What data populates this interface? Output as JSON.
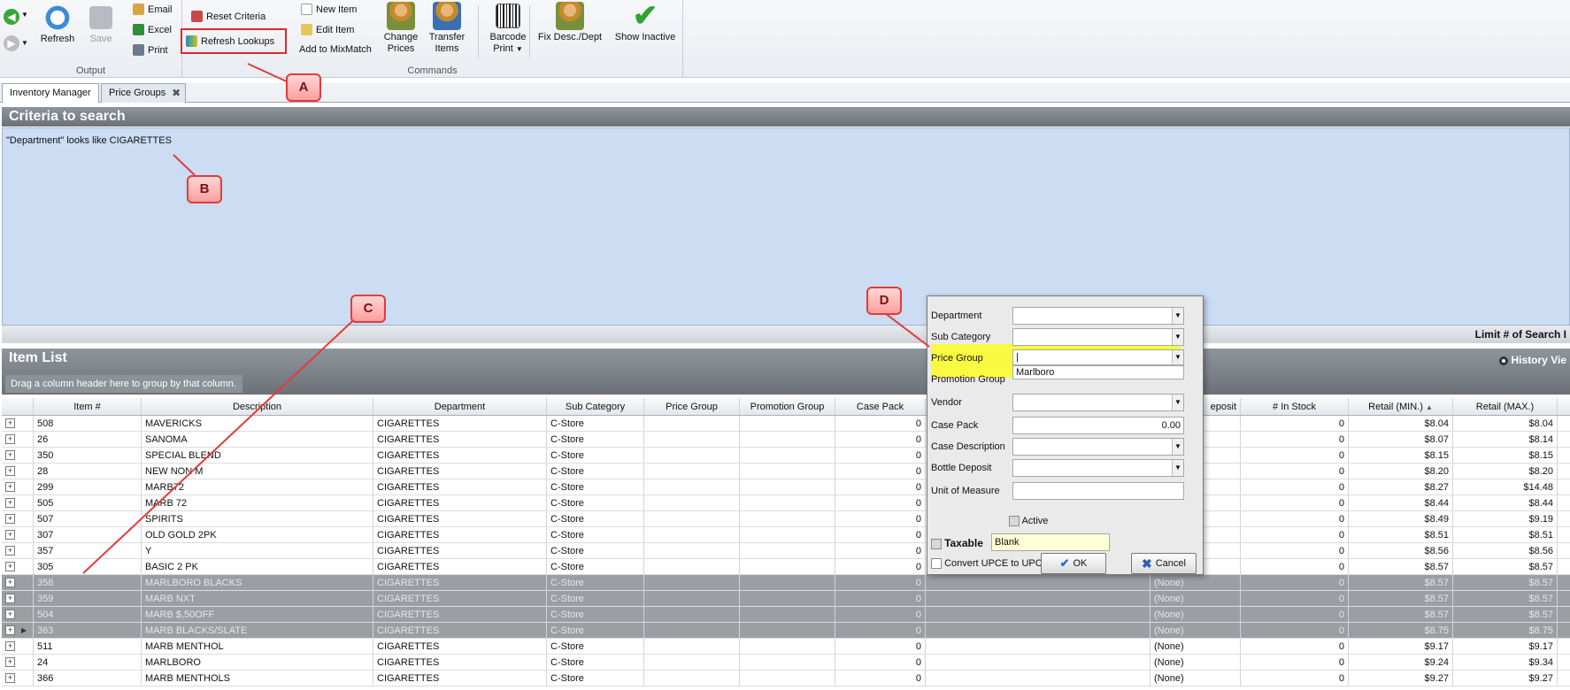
{
  "ribbon": {
    "output_group": "Output",
    "commands_group": "Commands",
    "refresh": "Refresh",
    "save": "Save",
    "email": "Email",
    "excel": "Excel",
    "print": "Print",
    "reset_criteria": "Reset Criteria",
    "refresh_lookups": "Refresh Lookups",
    "new_item": "New Item",
    "edit_item": "Edit Item",
    "add_mixmatch": "Add to MixMatch",
    "change_prices": "Change\nPrices",
    "change_prices_1": "Change",
    "change_prices_2": "Prices",
    "transfer_1": "Transfer",
    "transfer_2": "Items",
    "barcode_1": "Barcode",
    "barcode_2": "Print",
    "fix_desc": "Fix Desc./Dept",
    "show_inactive": "Show Inactive"
  },
  "callouts": {
    "a": "A",
    "b": "B",
    "c": "C",
    "d": "D"
  },
  "tabs": [
    {
      "label": "Inventory Manager"
    },
    {
      "label": "Price Groups"
    }
  ],
  "criteria": {
    "title": "Criteria to search",
    "text": "\"Department\" looks like CIGARETTES",
    "limit": "Limit # of Search I"
  },
  "item_list": {
    "title": "Item List",
    "group_hint": "Drag a column header here to group by that column.",
    "history": "History Vie"
  },
  "columns": {
    "item": "Item #",
    "desc": "Description",
    "dept": "Department",
    "subcat": "Sub Category",
    "pricegroup": "Price Group",
    "promo": "Promotion Group",
    "casepack": "Case Pack",
    "deposit": "eposit",
    "instock": "# In Stock",
    "retailmin": "Retail (MIN.)",
    "retailmax": "Retail (MAX.)"
  },
  "rows": [
    {
      "item": "508",
      "desc": "MAVERICKS",
      "dept": "CIGARETTES",
      "subcat": "C-Store",
      "casepack": "0",
      "deposit": "",
      "instock": "0",
      "min": "$8.04",
      "max": "$8.04"
    },
    {
      "item": "26",
      "desc": "SANOMA",
      "dept": "CIGARETTES",
      "subcat": "C-Store",
      "casepack": "0",
      "deposit": "",
      "instock": "0",
      "min": "$8.07",
      "max": "$8.14"
    },
    {
      "item": "350",
      "desc": "SPECIAL BLEND",
      "dept": "CIGARETTES",
      "subcat": "C-Store",
      "casepack": "0",
      "deposit": "",
      "instock": "0",
      "min": "$8.15",
      "max": "$8.15"
    },
    {
      "item": "28",
      "desc": "NEW NON M",
      "dept": "CIGARETTES",
      "subcat": "C-Store",
      "casepack": "0",
      "deposit": "",
      "instock": "0",
      "min": "$8.20",
      "max": "$8.20"
    },
    {
      "item": "299",
      "desc": "MARB72",
      "dept": "CIGARETTES",
      "subcat": "C-Store",
      "casepack": "0",
      "deposit": "",
      "instock": "0",
      "min": "$8.27",
      "max": "$14.48"
    },
    {
      "item": "505",
      "desc": "MARB 72",
      "dept": "CIGARETTES",
      "subcat": "C-Store",
      "casepack": "0",
      "deposit": "",
      "instock": "0",
      "min": "$8.44",
      "max": "$8.44"
    },
    {
      "item": "507",
      "desc": "SPIRITS",
      "dept": "CIGARETTES",
      "subcat": "C-Store",
      "casepack": "0",
      "deposit": "",
      "instock": "0",
      "min": "$8.49",
      "max": "$9.19"
    },
    {
      "item": "307",
      "desc": "OLD GOLD 2PK",
      "dept": "CIGARETTES",
      "subcat": "C-Store",
      "casepack": "0",
      "deposit": "",
      "instock": "0",
      "min": "$8.51",
      "max": "$8.51"
    },
    {
      "item": "357",
      "desc": "Y",
      "dept": "CIGARETTES",
      "subcat": "C-Store",
      "casepack": "0",
      "deposit": "",
      "instock": "0",
      "min": "$8.56",
      "max": "$8.56"
    },
    {
      "item": "305",
      "desc": "BASIC 2 PK",
      "dept": "CIGARETTES",
      "subcat": "C-Store",
      "casepack": "0",
      "deposit": "",
      "instock": "0",
      "min": "$8.57",
      "max": "$8.57"
    },
    {
      "item": "358",
      "desc": "MARLBORO BLACKS",
      "dept": "CIGARETTES",
      "subcat": "C-Store",
      "casepack": "0",
      "deposit": "(None)",
      "instock": "0",
      "min": "$8.57",
      "max": "$8.57"
    },
    {
      "item": "359",
      "desc": "MARB NXT",
      "dept": "CIGARETTES",
      "subcat": "C-Store",
      "casepack": "0",
      "deposit": "(None)",
      "instock": "0",
      "min": "$8.57",
      "max": "$8.57"
    },
    {
      "item": "504",
      "desc": "MARB $,50OFF",
      "dept": "CIGARETTES",
      "subcat": "C-Store",
      "casepack": "0",
      "deposit": "(None)",
      "instock": "0",
      "min": "$8.57",
      "max": "$8.57"
    },
    {
      "item": "363",
      "desc": "MARB BLACKS/SLATE",
      "dept": "CIGARETTES",
      "subcat": "C-Store",
      "casepack": "0",
      "deposit": "(None)",
      "instock": "0",
      "min": "$8.75",
      "max": "$8.75"
    },
    {
      "item": "511",
      "desc": "MARB MENTHOL",
      "dept": "CIGARETTES",
      "subcat": "C-Store",
      "casepack": "0",
      "deposit": "(None)",
      "instock": "0",
      "min": "$9.17",
      "max": "$9.17"
    },
    {
      "item": "24",
      "desc": "MARLBORO",
      "dept": "CIGARETTES",
      "subcat": "C-Store",
      "casepack": "0",
      "deposit": "(None)",
      "instock": "0",
      "min": "$9.24",
      "max": "$9.34"
    },
    {
      "item": "366",
      "desc": "MARB MENTHOLS",
      "dept": "CIGARETTES",
      "subcat": "C-Store",
      "casepack": "0",
      "deposit": "(None)",
      "instock": "0",
      "min": "$9.27",
      "max": "$9.27"
    }
  ],
  "dialog": {
    "department": "Department",
    "subcategory": "Sub Category",
    "pricegroup": "Price Group",
    "pricegroup_option": "Marlboro",
    "promotion": "Promotion Group",
    "vendor": "Vendor",
    "casepack": "Case Pack",
    "casepack_value": "0.00",
    "casedesc": "Case Description",
    "bottle": "Bottle Deposit",
    "uom": "Unit of Measure",
    "active": "Active",
    "taxable": "Taxable",
    "taxable_value": "Blank",
    "convert": "Convert UPCE to UPCA",
    "ok": "OK",
    "cancel": "Cancel"
  },
  "colors": {
    "highlight": "#ffff00",
    "callout": "#e23b3b",
    "criteria_bg": "#cbdcf3"
  }
}
